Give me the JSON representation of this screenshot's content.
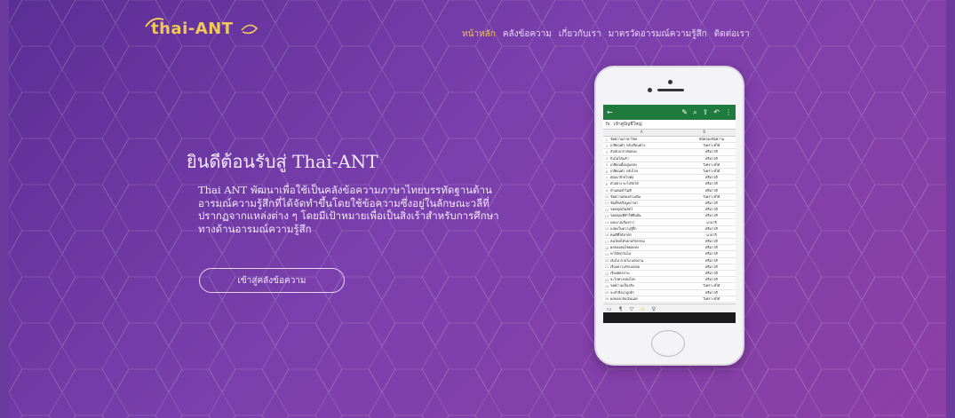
{
  "brand": {
    "logo_text": "thai-ANT",
    "logo_color": "#f0c75a"
  },
  "nav": {
    "items": [
      {
        "label": "หน้าหลัก",
        "active": true
      },
      {
        "label": "คลังข้อความ",
        "active": false
      },
      {
        "label": "เกี่ยวกับเรา",
        "active": false
      },
      {
        "label": "มาตรวัดอารมณ์ความรู้สึก",
        "active": false
      },
      {
        "label": "ติดต่อเรา",
        "active": false
      }
    ]
  },
  "hero": {
    "welcome": "ยินดีต้อนรับสู่ Thai-ANT",
    "description": "Thai ANT พัฒนาเพื่อใช้เป็นคลังข้อความภาษาไทยบรรทัดฐานด้านอารมณ์ความรู้สึกที่ได้จัดทำขึ้นโดยใช้ข้อความซึ่งอยู่ในลักษณะวลีที่ปรากฏจากแหล่งต่าง ๆ โดยมีเป้าหมายเพื่อเป็นสิ่งเร้าสำหรับการศึกษาทางด้านอารมณ์ความรู้สึก",
    "cta_label": "เข้าสู่คลังข้อความ"
  },
  "phone_sheet": {
    "formula_text": "เข้าสู่บัญชีใหญ่",
    "col_a": "A",
    "col_b": "B",
    "rows": [
      [
        "ข้อความภาษาไทย",
        "ชนิดของข้อความ"
      ],
      [
        "เกษียณตัว กลับเรียนต่าง",
        "วิเคราะห์ได้"
      ],
      [
        "ลับลับอากาศลดลง",
        "ครีมาวดี"
      ],
      [
        "กินไม่ได้แล้ว",
        "ครีมาวดี"
      ],
      [
        "เกษียณตั้งอยู่แหล่ง",
        "วิเคราะห์ได้"
      ],
      [
        "เกษียณตัว กลับไกล",
        "วิเคราะห์ได้"
      ],
      [
        "คุณนาย้ายไปต่อ",
        "ครีมาวดี"
      ],
      [
        "ตัวอย่าง จะไปรับได้",
        "ครีมาวดี"
      ],
      [
        "บ้านคนทำไม่ดี",
        "ครีมาวดี"
      ],
      [
        "ข้อความพ้องสามเดิม",
        "วิเคราะห์ได้"
      ],
      [
        "ข้อเท็จจริงพูดภาษา",
        "ครีมาวดี"
      ],
      [
        "ขอบคุณกินสัตว์",
        "ครีมาวดี"
      ],
      [
        "ขอบคุณที่ทำให้ยืนยัน",
        "ครีมาวดี"
      ],
      [
        "แต่งงานเรื่องราว",
        "นาบาลี"
      ],
      [
        "แสดงในความรู้สึก",
        "ครีมาวดี"
      ],
      [
        "คนดีที่ได้ลาพัก",
        "นาบาลี"
      ],
      [
        "คนไทยได้ขยายกิจกรรม",
        "ครีมาวดี"
      ],
      [
        "ผลของคนไทยลดลง",
        "ครีมาวดี"
      ],
      [
        "หาได้ทุกวันไม่",
        "ครีมาวดี"
      ],
      [
        "เงินไม่ ตายไม่ แต่งงาน",
        "ครีมาวดี"
      ],
      [
        "เรื่องความรักบอกต่อ",
        "ครีมาวดี"
      ],
      [
        "เรื่องมิตรภาพ",
        "ครีมาวดี"
      ],
      [
        "จะไปทางของโลก",
        "ครีมาวดี"
      ],
      [
        "ขอความเป็นจริง",
        "วิเคราะห์ได้"
      ],
      [
        "จะทำสิ่งน่าลูกค้า",
        "ครีมาวดี"
      ],
      [
        "ผลของกลับเงินนอก",
        "วิเคราะห์ได้"
      ]
    ]
  }
}
